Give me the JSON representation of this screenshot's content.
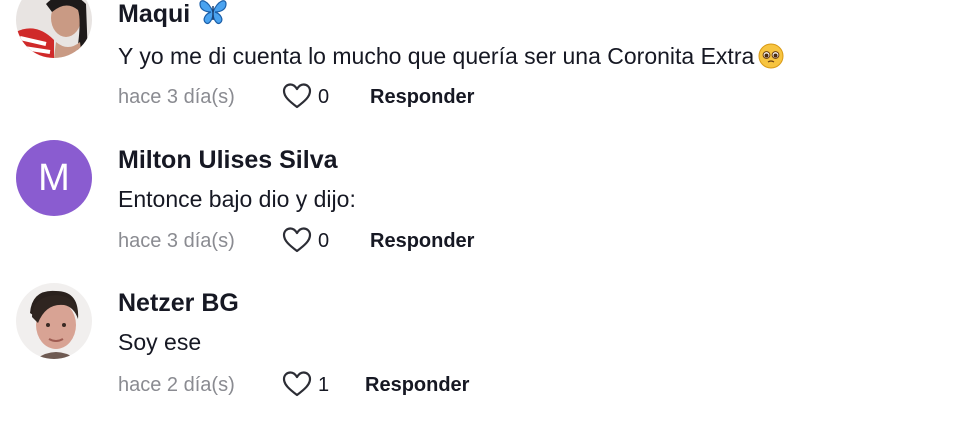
{
  "comments": [
    {
      "username": "Maqui",
      "username_emoji": "butterfly-icon",
      "text": "Y yo me di cuenta lo mucho que quería ser una Coronita Extra",
      "text_emoji": "pleading-face-icon",
      "time": "hace 3 día(s)",
      "likes": "0",
      "reply_label": "Responder"
    },
    {
      "username": "Milton Ulises Silva",
      "avatar_letter": "M",
      "avatar_color": "#8a5cd0",
      "text": "Entonce bajo dio y dijo:",
      "time": "hace 3 día(s)",
      "likes": "0",
      "reply_label": "Responder"
    },
    {
      "username": "Netzer BG",
      "text": "Soy ese",
      "time": "hace 2 día(s)",
      "likes": "1",
      "reply_label": "Responder"
    }
  ],
  "colors": {
    "primary_text": "#161823",
    "secondary_text": "#8a8b91",
    "butterfly": "#4aa3f0"
  }
}
